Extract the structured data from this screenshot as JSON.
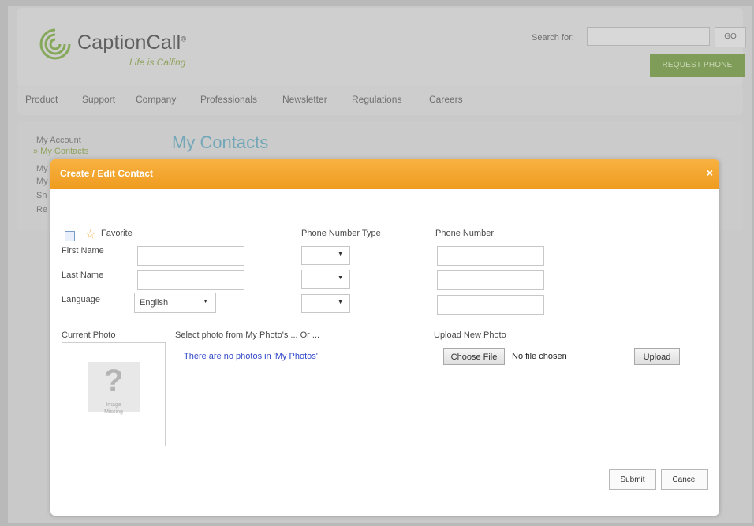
{
  "header": {
    "logo_text": "CaptionCall",
    "logo_tm": "®",
    "tagline": "Life is Calling",
    "search_label": "Search for:",
    "search_value": "",
    "go_label": "GO",
    "request_label": "REQUEST PHONE"
  },
  "nav": {
    "items": [
      "Product",
      "Support",
      "Company",
      "Professionals",
      "Newsletter",
      "Regulations",
      "Careers"
    ]
  },
  "sidebar": {
    "items": [
      "My Account",
      "» My Contacts",
      "My",
      "My",
      "Sh",
      "Re"
    ]
  },
  "content": {
    "title": "My Contacts"
  },
  "modal": {
    "title": "Create / Edit Contact",
    "close": "×",
    "favorite_label": "Favorite",
    "first_name_label": "First Name",
    "last_name_label": "Last Name",
    "language_label": "Language",
    "language_value": "English",
    "phone_type_header": "Phone Number Type",
    "phone_number_header": "Phone Number",
    "current_photo_label": "Current Photo",
    "photo_placeholder_q": "?",
    "photo_placeholder_caption1": "Image",
    "photo_placeholder_caption2": "Missing",
    "select_photo_label": "Select photo from My Photo's ... Or ...",
    "no_photos_text": "There are no photos in 'My Photos'",
    "upload_new_label": "Upload New Photo",
    "choose_file_label": "Choose File",
    "no_file_text": "No file chosen",
    "upload_label": "Upload",
    "submit_label": "Submit",
    "cancel_label": "Cancel"
  },
  "colors": {
    "brand_green": "#7f9c58",
    "modal_header_orange": "#f5a830",
    "title_blue": "#73a7b8",
    "link_blue": "#3048c8"
  },
  "icons": {
    "logo": "captioncall-logo",
    "favorite": "star-icon",
    "dropdown": "dropdown-arrow-icon",
    "close": "close-icon"
  }
}
